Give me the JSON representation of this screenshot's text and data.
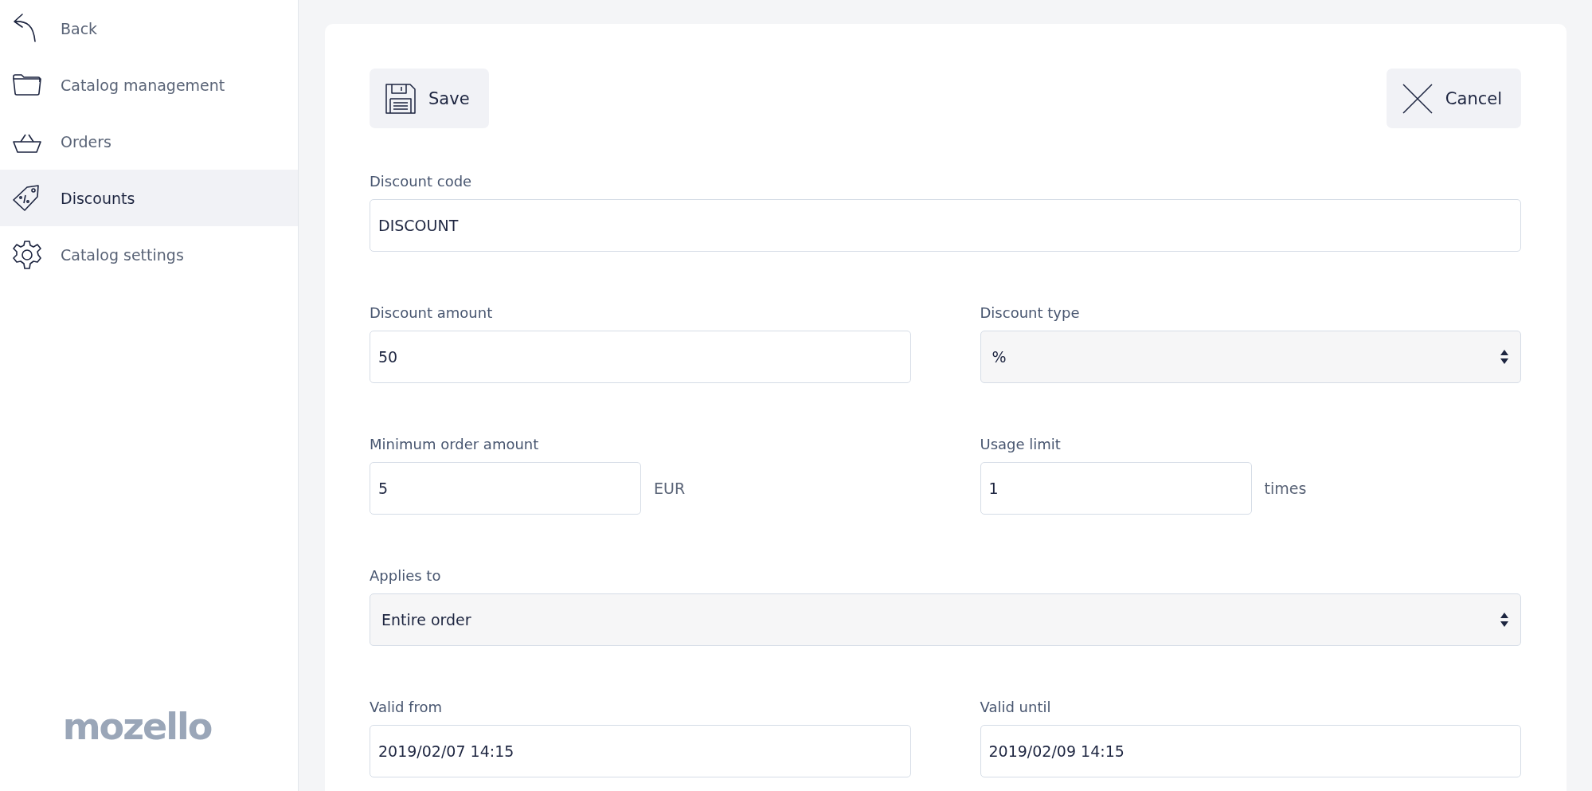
{
  "sidebar": {
    "items": [
      {
        "label": "Back",
        "selected": false
      },
      {
        "label": "Catalog management",
        "selected": false
      },
      {
        "label": "Orders",
        "selected": false
      },
      {
        "label": "Discounts",
        "selected": true
      },
      {
        "label": "Catalog settings",
        "selected": false
      }
    ],
    "logo": "mozello"
  },
  "toolbar": {
    "save": "Save",
    "cancel": "Cancel"
  },
  "form": {
    "rows": [
      [
        {
          "label": "Discount code",
          "kind": "text",
          "value": "DISCOUNT"
        }
      ],
      [
        {
          "label": "Discount amount",
          "kind": "text",
          "value": "50"
        },
        {
          "label": "Discount type",
          "kind": "select",
          "value": "%"
        }
      ],
      [
        {
          "label": "Minimum order amount",
          "kind": "text",
          "value": "5",
          "unit": "EUR"
        },
        {
          "label": "Usage limit",
          "kind": "text",
          "value": "1",
          "unit": "times"
        }
      ],
      [
        {
          "label": "Applies to",
          "kind": "select",
          "value": "Entire order"
        }
      ],
      [
        {
          "label": "Valid from",
          "kind": "text",
          "value": "2019/02/07 14:15"
        },
        {
          "label": "Valid until",
          "kind": "text",
          "value": "2019/02/09 14:15"
        }
      ]
    ]
  }
}
